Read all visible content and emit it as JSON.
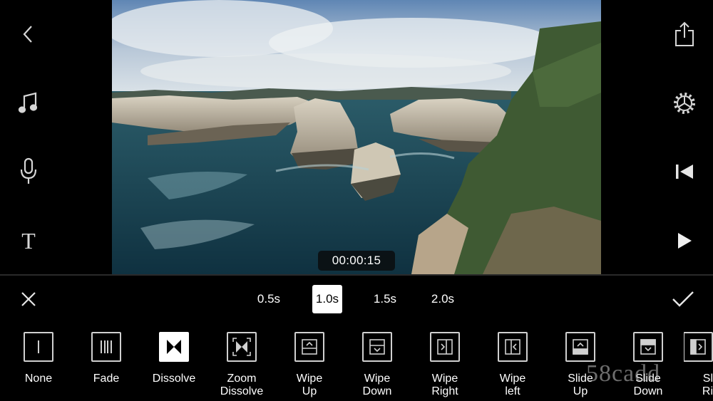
{
  "left_toolbar": {
    "back_icon": "chevron-left-icon",
    "music_icon": "music-note-icon",
    "mic_icon": "microphone-icon",
    "text_icon": "text-icon",
    "text_glyph": "T"
  },
  "right_toolbar": {
    "share_icon": "share-icon",
    "settings_icon": "gear-icon",
    "rewind_icon": "skip-to-start-icon",
    "play_icon": "play-icon"
  },
  "preview": {
    "timecode": "00:00:15"
  },
  "durations": [
    {
      "label": "0.5s",
      "selected": false
    },
    {
      "label": "1.0s",
      "selected": true
    },
    {
      "label": "1.5s",
      "selected": false
    },
    {
      "label": "2.0s",
      "selected": false
    }
  ],
  "transitions": [
    {
      "label": "None",
      "icon": "none-transition-icon",
      "selected": false
    },
    {
      "label": "Fade",
      "icon": "fade-transition-icon",
      "selected": false
    },
    {
      "label": "Dissolve",
      "icon": "dissolve-transition-icon",
      "selected": true
    },
    {
      "label": "Zoom\nDissolve",
      "icon": "zoom-dissolve-transition-icon",
      "selected": false
    },
    {
      "label": "Wipe\nUp",
      "icon": "wipe-up-transition-icon",
      "selected": false
    },
    {
      "label": "Wipe\nDown",
      "icon": "wipe-down-transition-icon",
      "selected": false
    },
    {
      "label": "Wipe\nRight",
      "icon": "wipe-right-transition-icon",
      "selected": false
    },
    {
      "label": "Wipe\nleft",
      "icon": "wipe-left-transition-icon",
      "selected": false
    },
    {
      "label": "Slide\nUp",
      "icon": "slide-up-transition-icon",
      "selected": false
    },
    {
      "label": "Slide\nDown",
      "icon": "slide-down-transition-icon",
      "selected": false
    },
    {
      "label": "Sl\nRi",
      "icon": "slide-right-transition-icon",
      "selected": false
    }
  ],
  "watermark": "58cadd",
  "colors": {
    "background": "#000000",
    "icon": "#d6d6d6",
    "selected": "#ffffff"
  }
}
